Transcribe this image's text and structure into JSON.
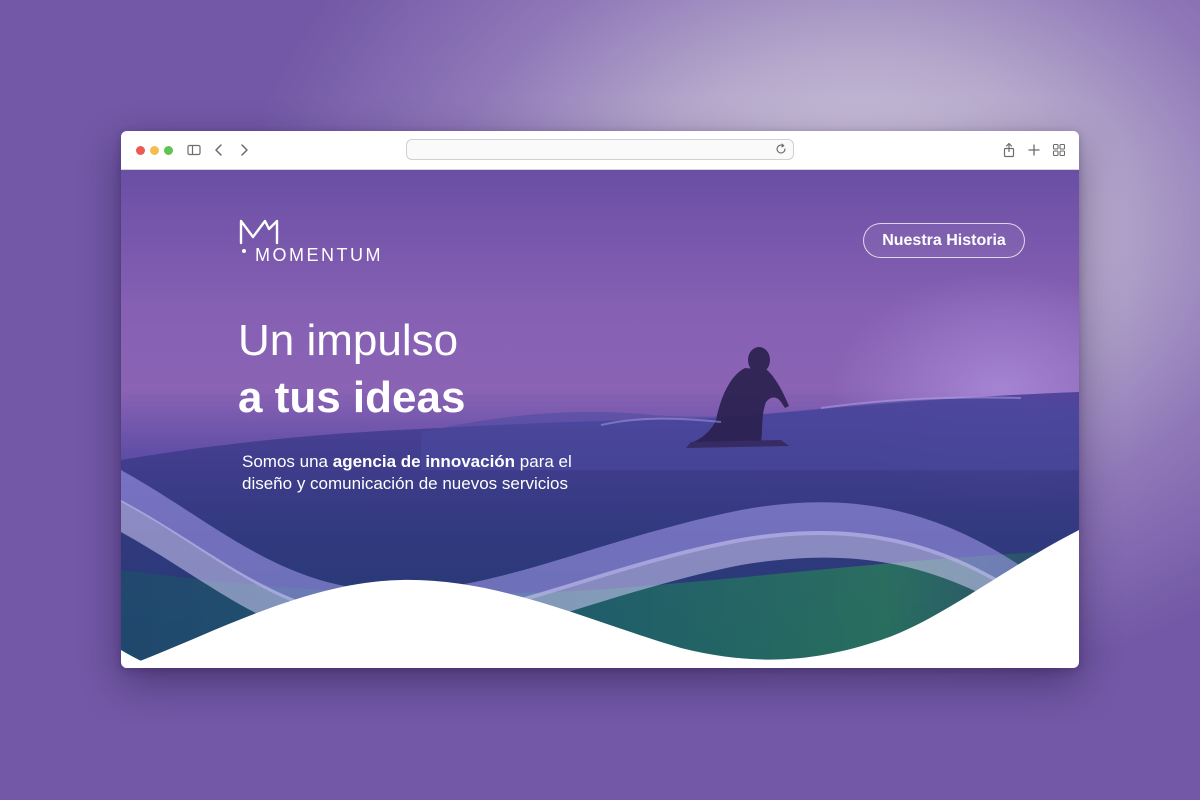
{
  "browser": {
    "address_value": "",
    "icons": [
      "sidebar-icon",
      "back-icon",
      "forward-icon",
      "reload-icon",
      "share-icon",
      "new-tab-icon",
      "tab-overview-icon"
    ]
  },
  "site": {
    "brand": "MOMENTUM",
    "nav_button": "Nuestra Historia",
    "headline_line1": "Un impulso",
    "headline_line2": "a tus ideas",
    "tagline_part1": "Somos una ",
    "tagline_bold": "agencia de innovación",
    "tagline_part2": " para el",
    "tagline_line2": "diseño y comunicación de nuevos servicios"
  },
  "colors": {
    "accent_purple": "#8660b3",
    "deep_blue": "#27367a",
    "wave_lilac": "#a79ff0",
    "white": "#ffffff"
  }
}
